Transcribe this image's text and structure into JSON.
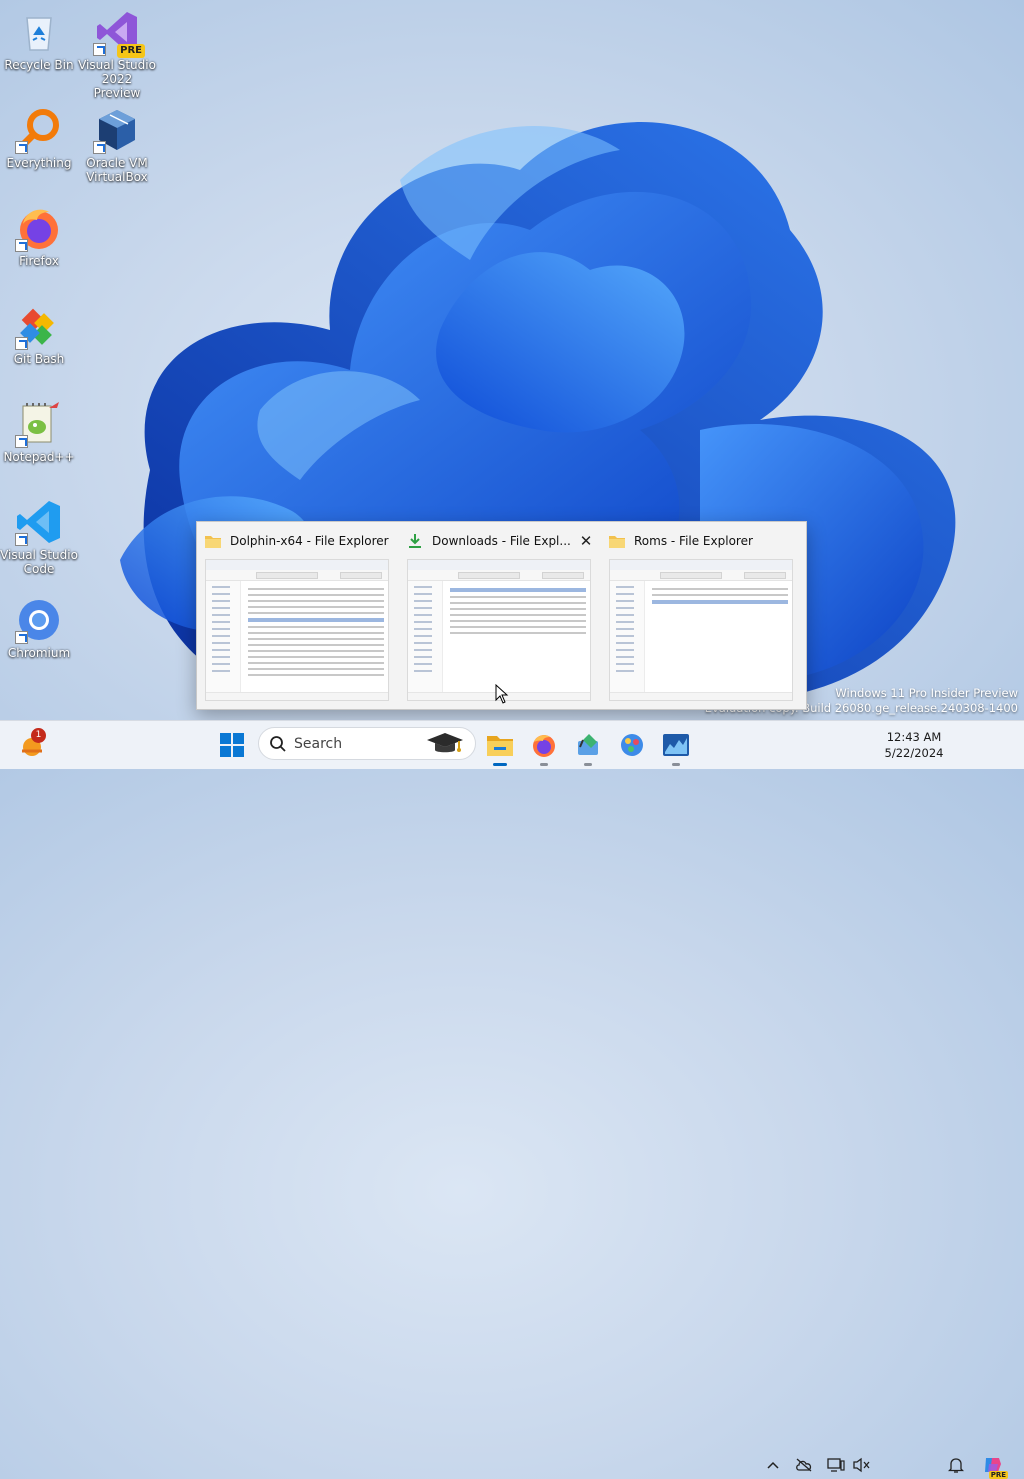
{
  "desktop": {
    "icons": [
      {
        "label": "Recycle Bin"
      },
      {
        "label": "Visual Studio 2022 Preview",
        "badge": "PRE"
      },
      {
        "label": "Everything"
      },
      {
        "label": "Oracle VM VirtualBox"
      },
      {
        "label": "Firefox"
      },
      {
        "label": "Git Bash"
      },
      {
        "label": "Notepad++"
      },
      {
        "label": "Visual Studio Code"
      },
      {
        "label": "Chromium"
      }
    ]
  },
  "watermark": {
    "line1": "Windows 11 Pro Insider Preview",
    "line2": "Evaluation copy. Build 26080.ge_release.240308-1400"
  },
  "task_thumbnails": [
    {
      "title": "Dolphin-x64 - File Explorer",
      "icon": "folder-icon"
    },
    {
      "title": "Downloads - File Expl...",
      "icon": "download-icon",
      "close": "✕"
    },
    {
      "title": "Roms - File Explorer",
      "icon": "folder-icon"
    }
  ],
  "taskbar": {
    "widgets_badge": "1",
    "search_placeholder": "Search",
    "apps": [
      "start-icon",
      "file-explorer-icon",
      "firefox-icon",
      "paint-icon",
      "photos-icon",
      "chart-app-icon"
    ],
    "tray": {
      "time": "12:43 AM",
      "date": "5/22/2024",
      "copilot_badge": "PRE"
    }
  },
  "colors": {
    "accent": "#0067c0",
    "taskbar": "#eef2f8",
    "wallpaper_blue": "#1a5fe0"
  }
}
